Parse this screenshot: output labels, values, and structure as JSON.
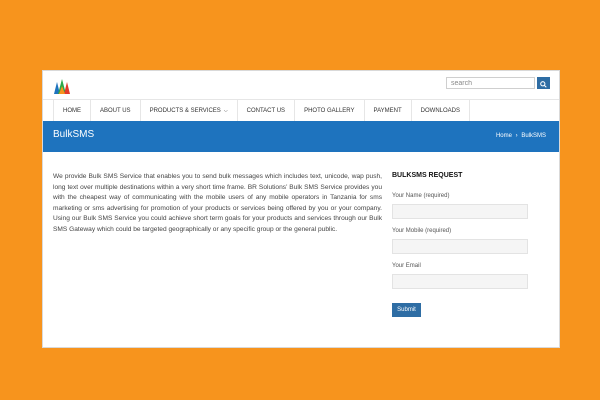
{
  "search": {
    "placeholder": "search"
  },
  "nav": [
    {
      "label": "HOME"
    },
    {
      "label": "ABOUT US"
    },
    {
      "label": "PRODUCTS & SERVICES"
    },
    {
      "label": "CONTACT US"
    },
    {
      "label": "PHOTO GALLERY"
    },
    {
      "label": "PAYMENT"
    },
    {
      "label": "DOWNLOADS"
    }
  ],
  "banner": {
    "title": "BulkSMS",
    "breadcrumb": {
      "home": "Home",
      "separator": "›",
      "current": "BulkSMS"
    }
  },
  "main": {
    "body": "We provide Bulk SMS Service that enables you to send bulk messages which includes text, unicode, wap push, long text over multiple destinations within a very short time frame. BR Solutions’ Bulk SMS Service provides you with the cheapest way of communicating with the mobile users of any mobile operators in Tanzania for sms marketing or sms advertising for promotion of your products or services being offered by you or your company. Using our Bulk SMS Service you could achieve short term goals for your products and services through our Bulk SMS Gateway which could be targeted geographically or any specific group or the general public."
  },
  "form": {
    "title": "BULKSMS REQUEST",
    "name_label": "Your Name (required)",
    "mobile_label": "Your Mobile (required)",
    "email_label": "Your Email",
    "submit_label": "Submit"
  },
  "colors": {
    "page_bg": "#f7941d",
    "banner": "#1e73be",
    "button": "#2e6da4"
  }
}
